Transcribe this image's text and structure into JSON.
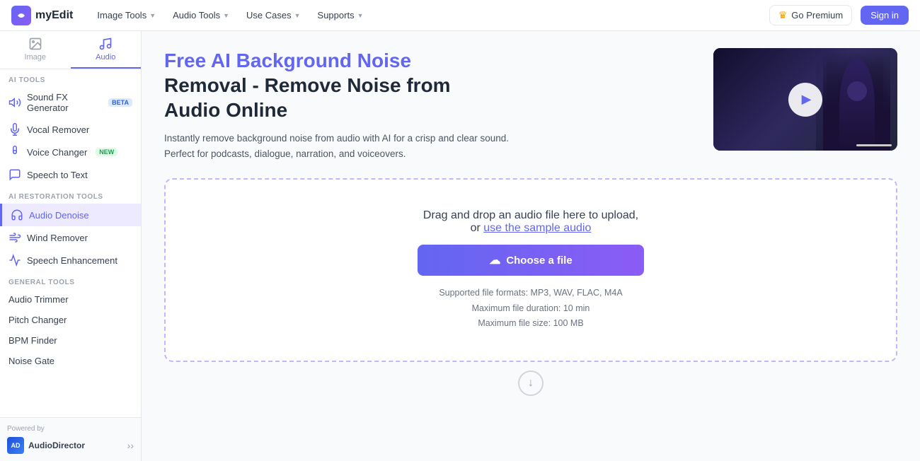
{
  "navbar": {
    "logo_text": "myEdit",
    "nav_items": [
      {
        "label": "Image Tools",
        "has_chevron": true
      },
      {
        "label": "Audio Tools",
        "has_chevron": true
      },
      {
        "label": "Use Cases",
        "has_chevron": true
      },
      {
        "label": "Supports",
        "has_chevron": true
      }
    ],
    "premium_label": "Go Premium",
    "signin_label": "Sign in"
  },
  "sidebar": {
    "tabs": [
      {
        "label": "Image",
        "active": false
      },
      {
        "label": "Audio",
        "active": true
      }
    ],
    "sections": [
      {
        "label": "AI TOOLS",
        "items": [
          {
            "label": "Sound FX Generator",
            "badge": "BETA",
            "badge_type": "beta",
            "active": false
          },
          {
            "label": "Vocal Remover",
            "badge": null,
            "active": false
          },
          {
            "label": "Voice Changer",
            "badge": "NEW",
            "badge_type": "new",
            "active": false
          },
          {
            "label": "Speech to Text",
            "badge": null,
            "active": false
          }
        ]
      },
      {
        "label": "AI RESTORATION TOOLS",
        "items": [
          {
            "label": "Audio Denoise",
            "badge": null,
            "active": true
          },
          {
            "label": "Wind Remover",
            "badge": null,
            "active": false
          },
          {
            "label": "Speech Enhancement",
            "badge": null,
            "active": false
          }
        ]
      },
      {
        "label": "GENERAL TOOLS",
        "items": [
          {
            "label": "Audio Trimmer",
            "badge": null,
            "active": false
          },
          {
            "label": "Pitch Changer",
            "badge": null,
            "active": false
          },
          {
            "label": "BPM Finder",
            "badge": null,
            "active": false
          },
          {
            "label": "Noise Gate",
            "badge": null,
            "active": false
          }
        ]
      }
    ],
    "footer": {
      "powered_by": "Powered by",
      "brand_name": "AudioDirector"
    }
  },
  "hero": {
    "title_line1": "Free AI Background Noise",
    "title_line2": "Removal - Remove Noise from",
    "title_line3": "Audio Online",
    "description": "Instantly remove background noise from audio with AI for a crisp and clear sound. Perfect for podcasts, dialogue, narration, and voiceovers."
  },
  "upload": {
    "drag_text": "Drag and drop an audio file here to upload,",
    "or_text": "or",
    "sample_link": "use the sample audio",
    "choose_label": "Choose a file",
    "format_label": "Supported file formats: MP3, WAV, FLAC, M4A",
    "duration_label": "Maximum file duration: 10 min",
    "size_label": "Maximum file size: 100 MB"
  }
}
